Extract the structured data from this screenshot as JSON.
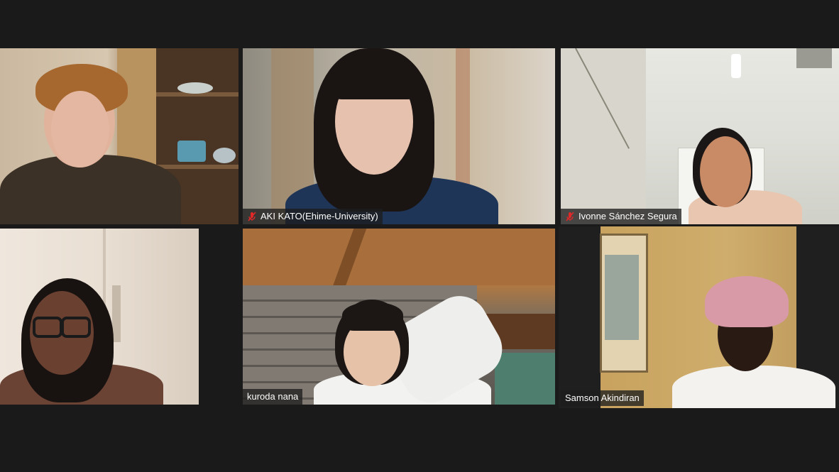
{
  "participants": [
    {
      "name": "",
      "muted": false
    },
    {
      "name": "AKI KATO(Ehime-University)",
      "muted": true
    },
    {
      "name": "Ivonne Sánchez Segura",
      "muted": true
    },
    {
      "name": "",
      "muted": false
    },
    {
      "name": "kuroda nana",
      "muted": false
    },
    {
      "name": "Samson Akindiran",
      "muted": false
    }
  ],
  "colors": {
    "background": "#1a1a1a",
    "active_speaker_border": "#d6ea43",
    "muted_icon": "#e02828"
  },
  "icons": {
    "muted": "microphone-muted-icon"
  }
}
